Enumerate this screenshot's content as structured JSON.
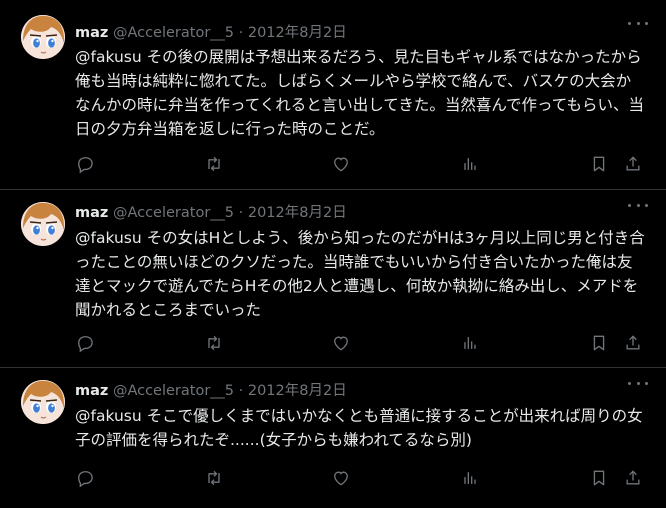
{
  "tweets": [
    {
      "name": "maz",
      "handle": "@Accelerator__5",
      "sep": "·",
      "date": "2012年8月2日",
      "text": "@fakusu その後の展開は予想出来るだろう、見た目もギャル系ではなかったから俺も当時は純粋に惚れてた。しばらくメールやら学校で絡んで、バスケの大会かなんかの時に弁当を作ってくれると言い出してきた。当然喜んで作ってもらい、当日の夕方弁当箱を返しに行った時のことだ。"
    },
    {
      "name": "maz",
      "handle": "@Accelerator__5",
      "sep": "·",
      "date": "2012年8月2日",
      "text": "@fakusu その女はHとしよう、後から知ったのだがHは3ヶ月以上同じ男と付き合ったことの無いほどのクソだった。当時誰でもいいから付き合いたかった俺は友達とマックで遊んでたらHその他2人と遭遇し、何故か執拗に絡み出し、メアドを聞かれるところまでいった"
    },
    {
      "name": "maz",
      "handle": "@Accelerator__5",
      "sep": "·",
      "date": "2012年8月2日",
      "text": "@fakusu そこで優しくまではいかなくとも普通に接することが出来れば周りの女子の評価を得られたぞ......(女子からも嫌われてるなら別)"
    }
  ],
  "icons": {
    "reply": "reply-icon",
    "retweet": "retweet-icon",
    "like": "like-icon",
    "views": "views-icon",
    "bookmark": "bookmark-icon",
    "share": "share-icon",
    "more": "more-icon"
  },
  "colors": {
    "background": "#000000",
    "text": "#e7e9ea",
    "muted": "#71767b",
    "divider": "#2f3336"
  }
}
